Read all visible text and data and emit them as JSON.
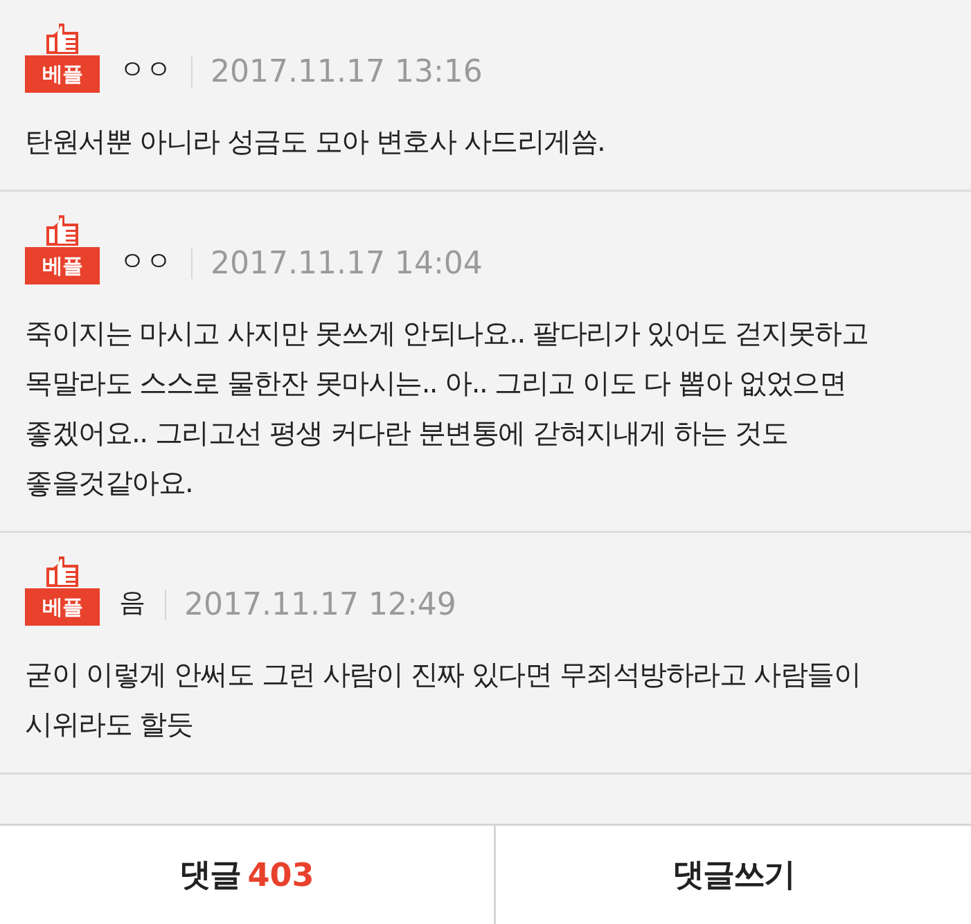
{
  "comments": [
    {
      "badge": "베플",
      "author": "ㅇㅇ",
      "date": "2017.11.17 13:16",
      "text": "탄원서뿐 아니라 성금도 모아 변호사 사드리게씀."
    },
    {
      "badge": "베플",
      "author": "ㅇㅇ",
      "date": "2017.11.17 14:04",
      "text": "죽이지는 마시고 사지만 못쓰게 안되나요.. 팔다리가 있어도 걷지못하고 목말라도 스스로 물한잔 못마시는.. 아.. 그리고 이도 다 뽑아 없었으면 좋겠어요.. 그리고선 평생 커다란 분변통에 갇혀지내게 하는 것도 좋을것같아요."
    },
    {
      "badge": "베플",
      "author": "음",
      "date": "2017.11.17 12:49",
      "text": "굳이 이렇게 안써도 그런 사람이 진짜 있다면 무죄석방하라고 사람들이 시위라도 할듯"
    }
  ],
  "footer": {
    "comment_label": "댓글",
    "comment_count": "403",
    "write_label": "댓글쓰기"
  }
}
